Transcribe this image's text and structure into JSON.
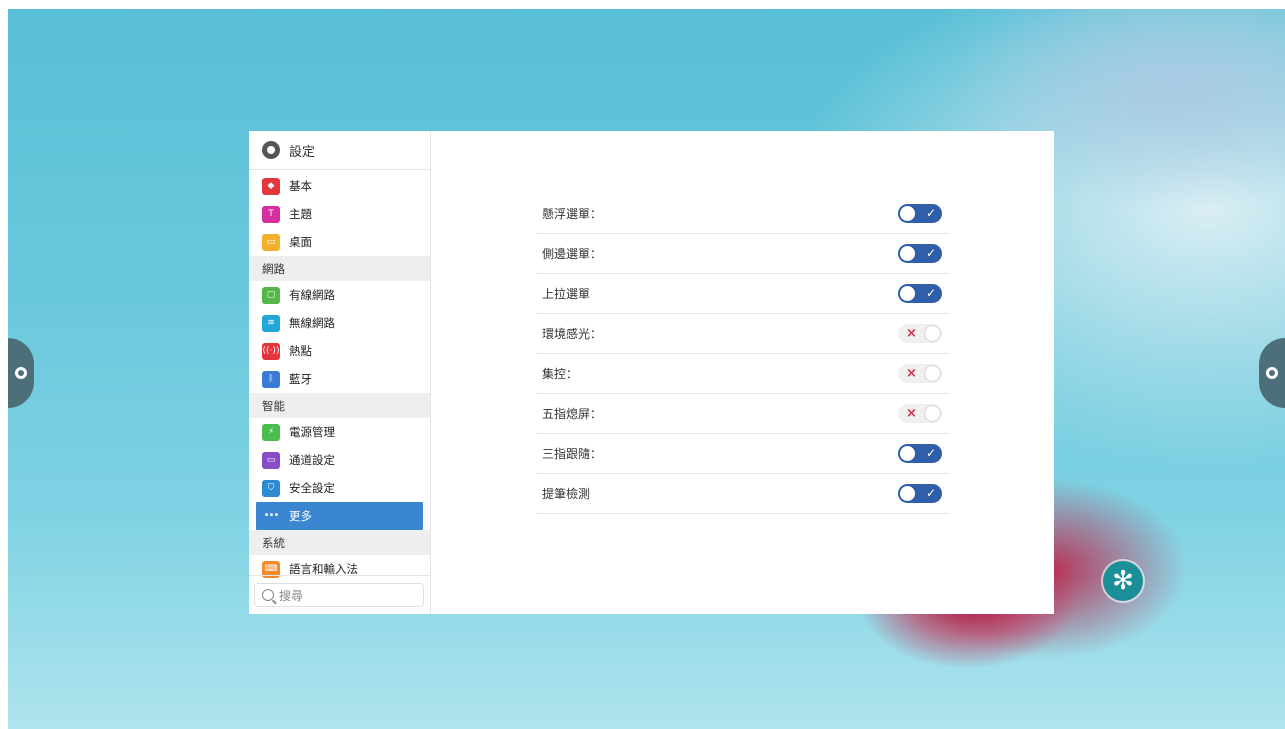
{
  "settings": {
    "title": "設定",
    "sidebar": {
      "items": [
        {
          "type": "item",
          "label": "基本",
          "icon": "layers-icon",
          "color": "#e2383d",
          "glyph": "◆"
        },
        {
          "type": "item",
          "label": "主題",
          "icon": "shirt-icon",
          "color": "#d62e9e",
          "glyph": "T"
        },
        {
          "type": "item",
          "label": "桌面",
          "icon": "image-icon",
          "color": "#f2b12c",
          "glyph": "▭"
        },
        {
          "type": "section",
          "label": "網路"
        },
        {
          "type": "item",
          "label": "有線網路",
          "icon": "ethernet-icon",
          "color": "#55b648",
          "glyph": "▢"
        },
        {
          "type": "item",
          "label": "無線網路",
          "icon": "wifi-icon",
          "color": "#22a7d8",
          "glyph": "≋"
        },
        {
          "type": "item",
          "label": "熱點",
          "icon": "hotspot-icon",
          "color": "#e5353c",
          "glyph": "((·))"
        },
        {
          "type": "item",
          "label": "藍牙",
          "icon": "bluetooth-icon",
          "color": "#3a7ad6",
          "glyph": "ᛒ"
        },
        {
          "type": "section",
          "label": "智能"
        },
        {
          "type": "item",
          "label": "電源管理",
          "icon": "power-icon",
          "color": "#4bbd4c",
          "glyph": "⚡"
        },
        {
          "type": "item",
          "label": "通道設定",
          "icon": "monitor-icon",
          "color": "#8a4bc7",
          "glyph": "▭"
        },
        {
          "type": "item",
          "label": "安全設定",
          "icon": "shield-icon",
          "color": "#2d8bd3",
          "glyph": "⛉"
        },
        {
          "type": "item",
          "label": "更多",
          "icon": "more-icon",
          "color": "#3a86d1",
          "glyph": "•••",
          "active": true
        },
        {
          "type": "section",
          "label": "系統"
        },
        {
          "type": "item",
          "label": "語言和輸入法",
          "icon": "keyboard-icon",
          "color": "#f08c2d",
          "glyph": "⌨"
        }
      ],
      "search_placeholder": "搜尋"
    },
    "options": [
      {
        "label": "懸浮選單：",
        "enabled": true
      },
      {
        "label": "側邊選單：",
        "enabled": true
      },
      {
        "label": "上拉選單",
        "enabled": true
      },
      {
        "label": "環境感光：",
        "enabled": false
      },
      {
        "label": "集控：",
        "enabled": false
      },
      {
        "label": "五指熄屏：",
        "enabled": false
      },
      {
        "label": "三指跟隨：",
        "enabled": true
      },
      {
        "label": "提筆檢測",
        "enabled": true
      }
    ],
    "toggle_on_mark": "✓",
    "toggle_off_mark": "×"
  },
  "overlay": {
    "left_handle_icon": "gear-icon",
    "right_handle_icon": "gear-icon",
    "float_button_icon": "flower-icon",
    "float_button_glyph": "✻"
  }
}
